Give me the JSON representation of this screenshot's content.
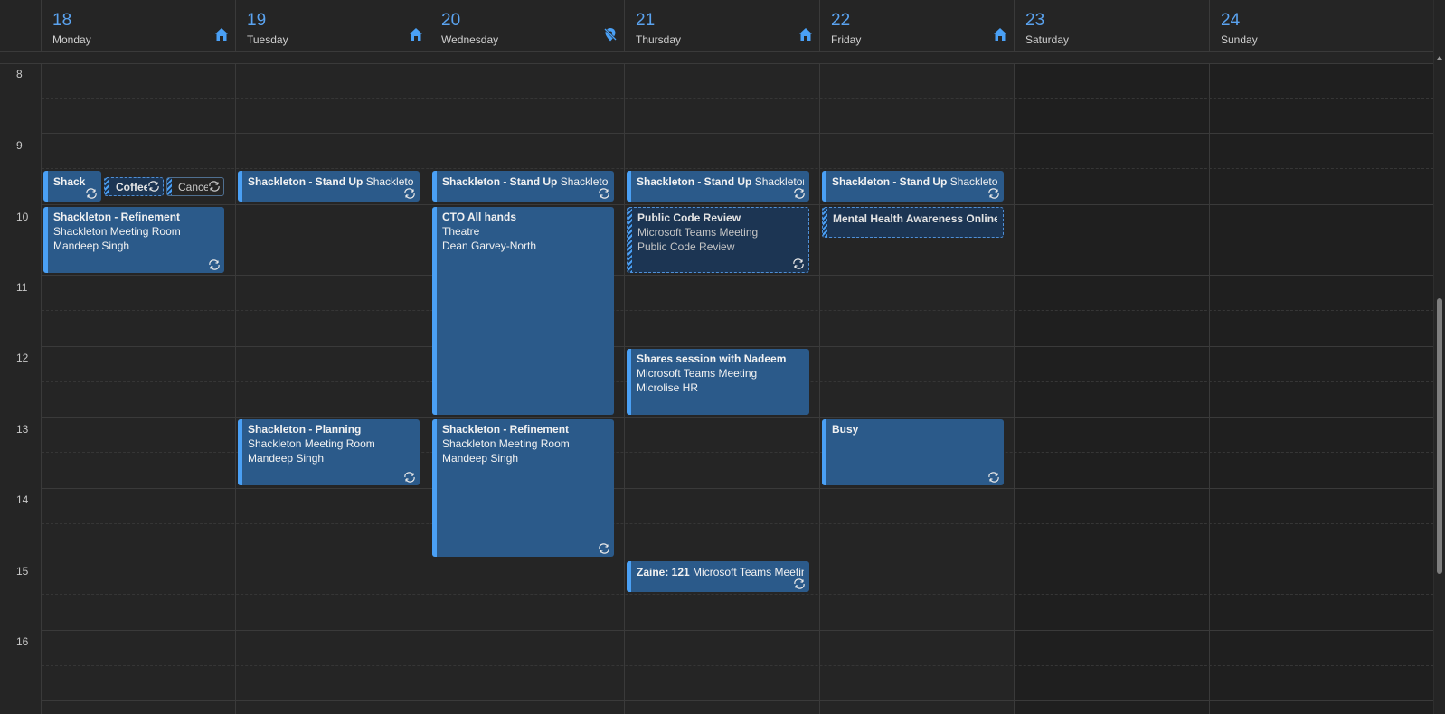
{
  "days": [
    {
      "num": "18",
      "name": "Monday",
      "icon": "home-icon"
    },
    {
      "num": "19",
      "name": "Tuesday",
      "icon": "home-icon"
    },
    {
      "num": "20",
      "name": "Wednesday",
      "icon": "location-off-icon"
    },
    {
      "num": "21",
      "name": "Thursday",
      "icon": "home-icon"
    },
    {
      "num": "22",
      "name": "Friday",
      "icon": "home-icon"
    },
    {
      "num": "23",
      "name": "Saturday",
      "icon": ""
    },
    {
      "num": "24",
      "name": "Sunday",
      "icon": ""
    }
  ],
  "hours": [
    "8",
    "9",
    "10",
    "11",
    "12",
    "13",
    "14",
    "15",
    "16"
  ],
  "events": {
    "mon_standup": {
      "title": "Shack"
    },
    "mon_coffee": {
      "title": "Coffee"
    },
    "mon_cancel": {
      "title": "Cancel"
    },
    "mon_refinement": {
      "title": "Shackleton - Refinement",
      "location": "Shackleton Meeting Room",
      "organizer": "Mandeep Singh"
    },
    "tue_standup": {
      "title": "Shackleton - Stand Up",
      "location": "Shackleton"
    },
    "tue_planning": {
      "title": "Shackleton - Planning",
      "location": "Shackleton Meeting Room",
      "organizer": "Mandeep Singh"
    },
    "wed_standup": {
      "title": "Shackleton - Stand Up",
      "location": "Shackleton"
    },
    "wed_cto": {
      "title": "CTO All hands",
      "location": "Theatre",
      "organizer": "Dean Garvey-North"
    },
    "wed_refinement": {
      "title": "Shackleton - Refinement",
      "location": "Shackleton Meeting Room",
      "organizer": "Mandeep Singh"
    },
    "thu_standup": {
      "title": "Shackleton - Stand Up",
      "location": "Shackleton"
    },
    "thu_codereview": {
      "title": "Public Code Review",
      "location": "Microsoft Teams Meeting",
      "organizer": "Public Code Review"
    },
    "thu_shares": {
      "title": "Shares session with Nadeem",
      "location": "Microsoft Teams Meeting",
      "organizer": "Microlise HR"
    },
    "thu_zaine": {
      "title": "Zaine: 121",
      "location": "Microsoft Teams Meeting"
    },
    "fri_standup": {
      "title": "Shackleton - Stand Up",
      "location": "Shackleton"
    },
    "fri_mental": {
      "title": "Mental Health Awareness Online course"
    },
    "fri_busy": {
      "title": "Busy"
    }
  },
  "colors": {
    "event_bg": "#2b5a8a",
    "event_accent": "#4aa0f5",
    "tentative_bg": "#1c3553",
    "day_number": "#5aa3f0"
  }
}
